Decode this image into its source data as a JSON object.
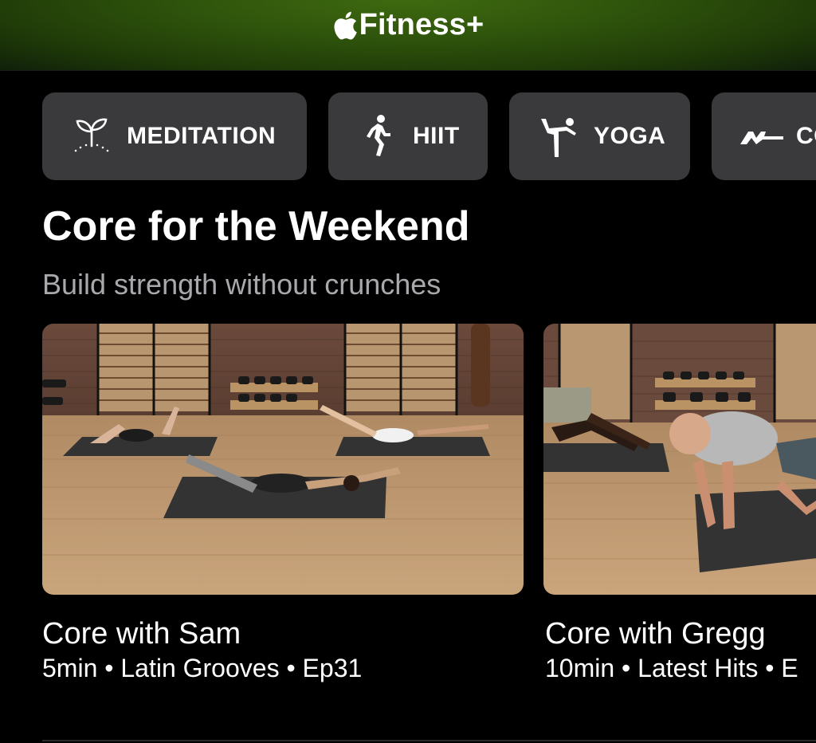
{
  "header": {
    "brand_name": "Fitness+",
    "brand_icon": "apple-logo-icon",
    "background_color": "#2c500b"
  },
  "categories": [
    {
      "label": "MEDITATION",
      "icon": "sprout-icon"
    },
    {
      "label": "HIIT",
      "icon": "running-person-icon"
    },
    {
      "label": "YOGA",
      "icon": "yoga-pose-icon"
    },
    {
      "label": "CO",
      "icon": "core-pose-icon"
    }
  ],
  "section": {
    "title": "Core for the Weekend",
    "subtitle": "Build strength without crunches"
  },
  "workouts": [
    {
      "title": "Core with Sam",
      "meta": "5min • Latin Grooves • Ep31"
    },
    {
      "title": "Core with Gregg",
      "meta": "10min • Latest Hits • E"
    }
  ],
  "colors": {
    "background": "#000000",
    "tile": "#3a3a3c",
    "subtitle": "#a9a9ad"
  }
}
